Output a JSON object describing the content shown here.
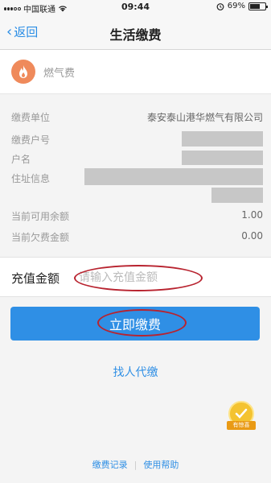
{
  "status": {
    "carrier": "中国联通",
    "time": "09:44",
    "battery": "69%",
    "battery_level": 0.69
  },
  "nav": {
    "back_label": "返回",
    "title": "生活缴费"
  },
  "header": {
    "name": "燃气费",
    "icon": "flame-icon",
    "icon_color": "#ef8a5b"
  },
  "info": {
    "company_label": "缴费单位",
    "company_value": "泰安泰山港华燃气有限公司",
    "account_label": "缴费户号",
    "name_label": "户名",
    "address_label": "住址信息",
    "balance_label": "当前可用余额",
    "balance_value": "1.00",
    "debt_label": "当前欠费金额",
    "debt_value": "0.00"
  },
  "recharge": {
    "label": "充值金额",
    "placeholder": "请输入充值金额"
  },
  "actions": {
    "pay_label": "立即缴费",
    "find_label": "找人代缴"
  },
  "badge": {
    "ribbon": "有惊喜"
  },
  "footer": {
    "records": "缴费记录",
    "help": "使用帮助"
  },
  "colors": {
    "accent": "#2f8fe5",
    "annotation": "#b8232f"
  }
}
